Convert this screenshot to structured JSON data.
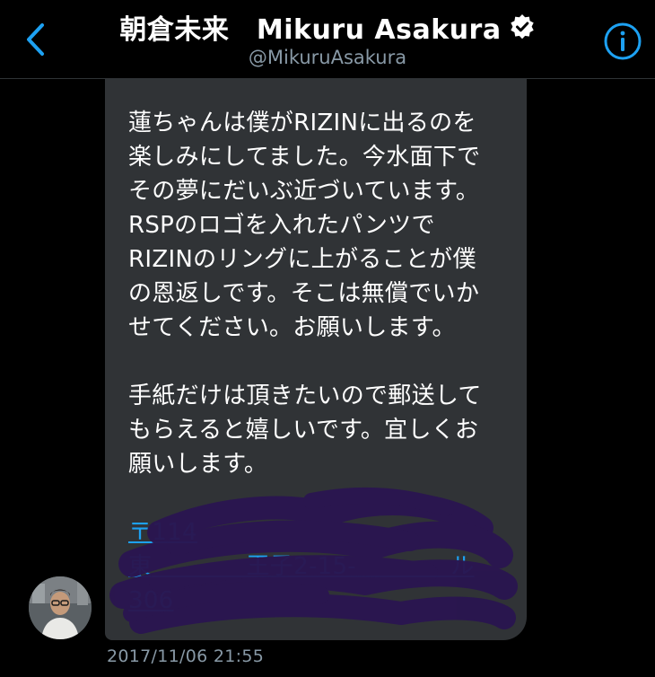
{
  "header": {
    "back_icon": "chevron-left-icon",
    "title": "朝倉未来　Mikuru Asakura",
    "verified_icon": "verified-badge-icon",
    "handle": "@MikuruAsakura",
    "info_icon": "info-circle-icon"
  },
  "message": {
    "lines": [
      "蓮ちゃんは僕がRIZINに出るのを",
      "楽しみにしてました。今水面下で",
      "その夢にだいぶ近づいています。",
      "RSPのロゴを入れたパンツで",
      "RIZINのリングに上がることが僕",
      "の恩返しです。そこは無償でいか",
      "せてください。お願いします。",
      "手紙だけは頂きたいので郵送して",
      "もらえると嬉しいです。宜しくお",
      "願いします。"
    ],
    "address_lines": [
      "〒114",
      "東　　　　王子2-15-　　　　ル",
      "306"
    ],
    "timestamp": "2017/11/06 21:55"
  },
  "colors": {
    "background": "#000000",
    "bubble": "#303336",
    "link": "#1da1f2",
    "secondary_text": "#8899a6",
    "redaction": "#2a1650"
  }
}
